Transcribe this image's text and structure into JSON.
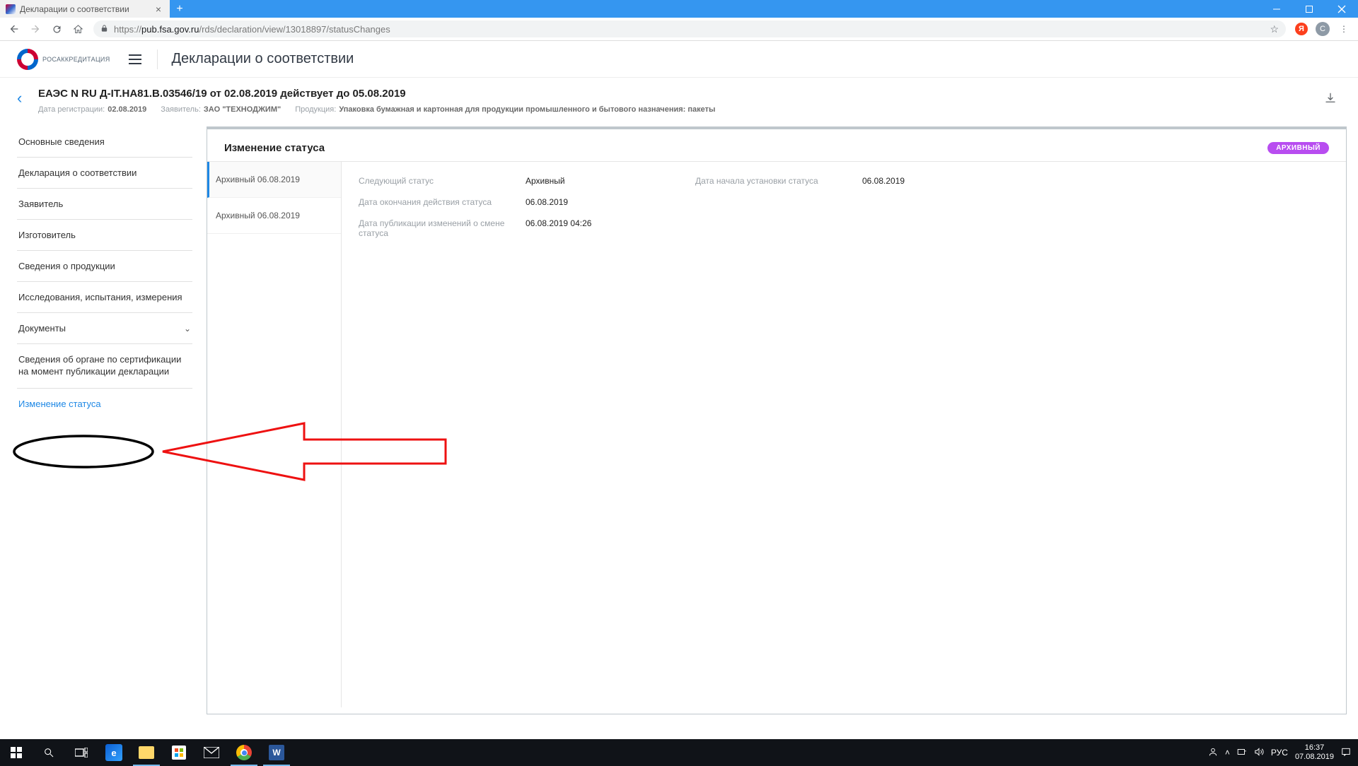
{
  "window": {
    "tab_title": "Декларации о соответствии",
    "url_host": "pub.fsa.gov.ru",
    "url_path": "/rds/declaration/view/13018897/statusChanges",
    "url_prefix": "https://"
  },
  "app": {
    "logo_text": "РОСАККРЕДИТАЦИЯ",
    "page_title": "Декларации о соответствии"
  },
  "declaration": {
    "title": "ЕАЭС N RU Д-IT.НА81.В.03546/19 от 02.08.2019 действует до 05.08.2019",
    "meta": {
      "reg_label": "Дата регистрации:",
      "reg_value": "02.08.2019",
      "applicant_label": "Заявитель:",
      "applicant_value": "ЗАО \"ТЕХНОДЖИМ\"",
      "product_label": "Продукция:",
      "product_value": "Упаковка бумажная и картонная для продукции промышленного и бытового назначения: пакеты"
    }
  },
  "sidebar": {
    "items": [
      "Основные сведения",
      "Декларация о соответствии",
      "Заявитель",
      "Изготовитель",
      "Сведения о продукции",
      "Исследования, испытания, измерения",
      "Документы",
      "Сведения об органе по сертификации на момент публикации декларации",
      "Изменение статуса"
    ]
  },
  "panel": {
    "heading": "Изменение статуса",
    "badge": "АРХИВНЫЙ",
    "history": [
      "Архивный 06.08.2019",
      "Архивный 06.08.2019"
    ],
    "details": {
      "next_status_label": "Следующий статус",
      "next_status_value": "Архивный",
      "start_date_label": "Дата начала установки статуса",
      "start_date_value": "06.08.2019",
      "end_date_label": "Дата окончания действия статуса",
      "end_date_value": "06.08.2019",
      "pub_date_label": "Дата публикации изменений о смене статуса",
      "pub_date_value": "06.08.2019 04:26"
    }
  },
  "taskbar": {
    "lang": "РУС",
    "time": "16:37",
    "date": "07.08.2019"
  }
}
